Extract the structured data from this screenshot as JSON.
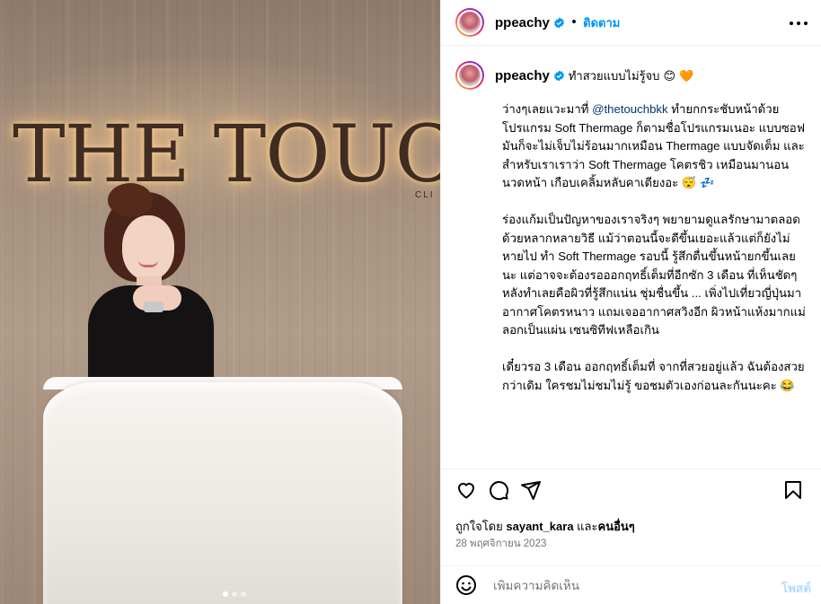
{
  "photo": {
    "sign_text": "THE TOUCH",
    "sign_sub": "CLI",
    "carousel_dots": 3,
    "active_dot": 1
  },
  "header": {
    "username": "ppeachy",
    "separator": "•",
    "follow_label": "ติดตาม"
  },
  "caption": {
    "username": "ppeachy",
    "title": "ทำสวยแบบไม่รู้จบ 😊 🧡",
    "p1_before": "ว่างๆเลยแวะมาที่ ",
    "p1_mention": "@thetouchbkk",
    "p1_after": " ทำยกกระชับหน้าด้วยโปรแกรม Soft Thermage ก็ตามชื่อโปรแกรมเนอะ แบบซอฟ มันก็จะไม่เจ็บไม่ร้อนมากเหมือน Thermage แบบจัดเต็ม และสำหรับเราเราว่า Soft Thermage โคตรชิว เหมือนมานอนนวดหน้า เกือบเคลิ้มหลับคาเตียงอะ 😴 💤",
    "p2": "ร่องแก้มเป็นปัญหาของเราจริงๆ พยายามดูแลรักษามาตลอดด้วยหลากหลายวิธี แม้ว่าตอนนี้จะดีขึ้นเยอะแล้วแต่ก็ยังไม่หายไป ทำ Soft Thermage รอบนี้ รู้สึกตื่นขึ้นหน้ายกขึ้นเลยนะ แต่อาจจะต้องรอออกฤทธิ์เต็มที่อีกซัก 3 เดือน ที่เห็นชัดๆหลังทำเลยคือผิวที่รู้สึกแน่น ชุ่มชื่นขึ้น ... เพิ่งไปเที่ยวญี่ปุ่นมา อากาศโคตรหนาว แถมเจออากาศสวิงอีก ผิวหน้าแห้งมากแม่ ลอกเป็นแผ่น เซนซิทีฟเหลือเกิน",
    "p3": "เดี๋ยวรอ 3 เดือน ออกฤทธิ์เต็มที่ จากที่สวยอยู่แล้ว ฉันต้องสวยกว่าเดิม ใครชมไม่ชมไม่รู้ ขอชมตัวเองก่อนละกันนะคะ 😂"
  },
  "likes": {
    "prefix": "ถูกใจโดย ",
    "user": "sayant_kara",
    "middle": " และ",
    "others": "คนอื่นๆ"
  },
  "date": "28 พฤศจิกายน 2023",
  "comment": {
    "placeholder": "เพิ่มความคิดเห็น",
    "post_label": "โพสต์"
  },
  "icons": {
    "more": "more-icon",
    "verified": "verified-icon",
    "like": "heart-icon",
    "comment": "comment-icon",
    "share": "share-icon",
    "save": "bookmark-icon",
    "emoji": "emoji-icon"
  },
  "colors": {
    "accent": "#0095f6",
    "mention": "#00376b",
    "muted": "#737373",
    "post_disabled": "#b3dbff"
  }
}
